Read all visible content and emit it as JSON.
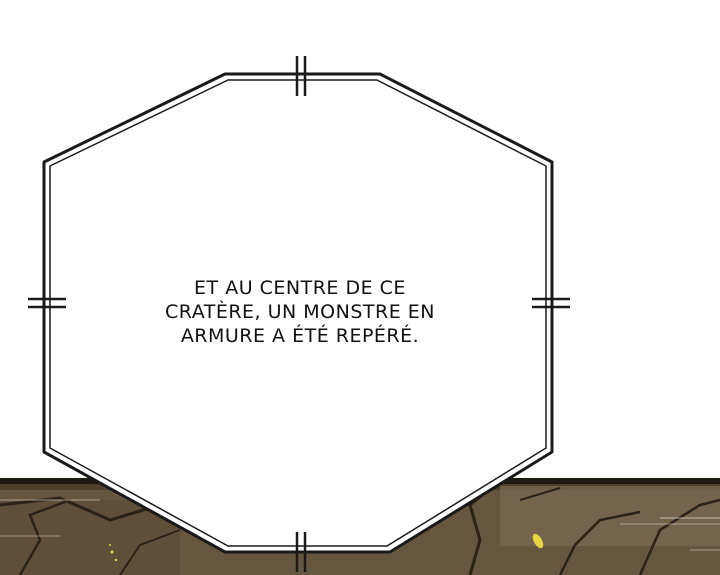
{
  "caption": {
    "lines": [
      "ET AU CENTRE DE CE",
      "CRATÈRE, UN MONSTRE EN",
      "ARMURE A ÉTÉ REPÉRÉ."
    ]
  },
  "colors": {
    "background": "#ffffff",
    "panel_border": "#1a1a1a",
    "ground_dark": "#2a2218",
    "ground_mid": "#5a4a34",
    "ground_light": "#7a6a52",
    "spark": "#e8d640"
  }
}
